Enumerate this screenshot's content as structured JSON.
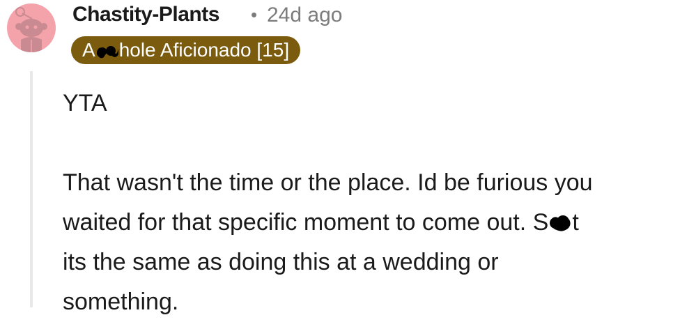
{
  "comment": {
    "username": "Chastity-Plants",
    "separator": "•",
    "timestamp": "24d ago",
    "flair": {
      "prefix": "A",
      "suffix": "hole Aficionado [15]",
      "background": "#7b5b0e"
    },
    "avatar": {
      "background": "#f5a3aa",
      "icon": "snoo-avatar-icon"
    },
    "body": {
      "paragraph1": "YTA",
      "line1": "That wasn't the time or the place. Id be furious you",
      "line2_before": "waited for that specific moment to come out. S",
      "line2_after": "t",
      "line3": "its the same as doing this at a wedding or",
      "line4": "something."
    }
  }
}
